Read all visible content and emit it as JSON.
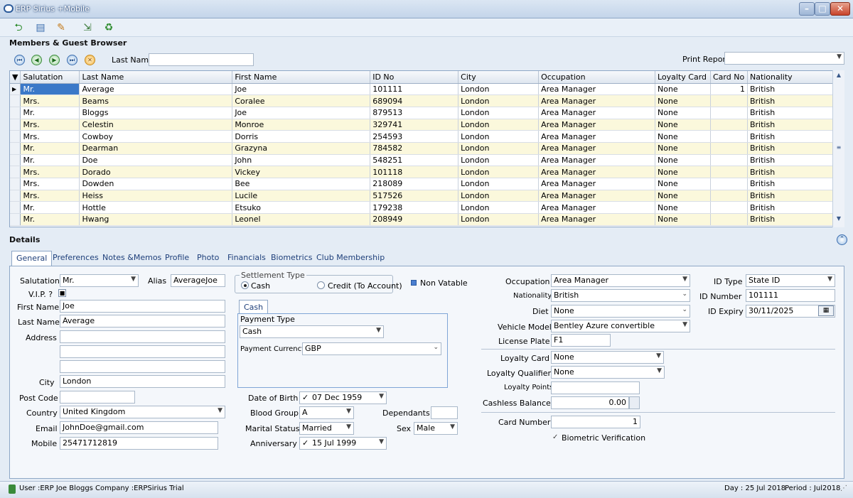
{
  "window": {
    "title": "ERP Sirius +Mobile",
    "minimize": "–",
    "maximize": "□",
    "close": "✕"
  },
  "toolbar": {
    "icons": [
      "refresh-icon",
      "new-document-icon",
      "edit-document-icon",
      "export-icon",
      "recycle-icon"
    ]
  },
  "browser": {
    "title": "Members & Guest Browser",
    "last_name_label": "Last Name",
    "last_name_value": "",
    "print_report_label": "Print Report",
    "print_report_value": ""
  },
  "grid": {
    "columns": [
      "Salutation",
      "Last Name",
      "First Name",
      "ID No",
      "City",
      "Occupation",
      "Loyalty Card",
      "Card No",
      "Nationality"
    ],
    "rows": [
      [
        "Mr.",
        "Average",
        "Joe",
        "101111",
        "London",
        "Area Manager",
        "None",
        "1",
        "British"
      ],
      [
        "Mrs.",
        "Beams",
        "Coralee",
        "689094",
        "London",
        "Area Manager",
        "None",
        "",
        "British"
      ],
      [
        "Mr.",
        "Bloggs",
        "Joe",
        "879513",
        "London",
        "Area Manager",
        "None",
        "",
        "British"
      ],
      [
        "Mrs.",
        "Celestin",
        "Monroe",
        "329741",
        "London",
        "Area Manager",
        "None",
        "",
        "British"
      ],
      [
        "Mrs.",
        "Cowboy",
        "Dorris",
        "254593",
        "London",
        "Area Manager",
        "None",
        "",
        "British"
      ],
      [
        "Mr.",
        "Dearman",
        "Grazyna",
        "784582",
        "London",
        "Area Manager",
        "None",
        "",
        "British"
      ],
      [
        "Mr.",
        "Doe",
        "John",
        "548251",
        "London",
        "Area Manager",
        "None",
        "",
        "British"
      ],
      [
        "Mrs.",
        "Dorado",
        "Vickey",
        "101118",
        "London",
        "Area Manager",
        "None",
        "",
        "British"
      ],
      [
        "Mrs.",
        "Dowden",
        "Bee",
        "218089",
        "London",
        "Area Manager",
        "None",
        "",
        "British"
      ],
      [
        "Mrs.",
        "Heiss",
        "Lucile",
        "517526",
        "London",
        "Area Manager",
        "None",
        "",
        "British"
      ],
      [
        "Mr.",
        "Hottle",
        "Etsuko",
        "179238",
        "London",
        "Area Manager",
        "None",
        "",
        "British"
      ],
      [
        "Mr.",
        "Hwang",
        "Leonel",
        "208949",
        "London",
        "Area Manager",
        "None",
        "",
        "British"
      ]
    ]
  },
  "details": {
    "title": "Details",
    "tabs": [
      "General",
      "Preferences",
      "Notes &Memos",
      "Profile",
      "Photo",
      "Financials",
      "Biometrics",
      "Club Membership"
    ],
    "salutation_label": "Salutation",
    "salutation_value": "Mr.",
    "alias_label": "Alias",
    "alias_value": "AverageJoe",
    "vip_label": "V.I.P. ?",
    "first_name_label": "First Name",
    "first_name_value": "Joe",
    "last_name_label": "Last Name",
    "last_name_value": "Average",
    "address_label": "Address",
    "city_label": "City",
    "city_value": "London",
    "post_code_label": "Post Code",
    "post_code_value": "",
    "country_label": "Country",
    "country_value": "United Kingdom",
    "email_label": "Email",
    "email_value": "JohnDoe@gmail.com",
    "mobile_label": "Mobile",
    "mobile_value": "25471712819",
    "settlement_label": "Settlement Type",
    "cash_label": "Cash",
    "credit_label": "Credit (To Account)",
    "non_vatable_label": "Non Vatable",
    "cash_tab": "Cash",
    "payment_type_label": "Payment Type",
    "payment_type_value": "Cash",
    "payment_currency_label": "Payment Currency",
    "payment_currency_value": "GBP",
    "dob_label": "Date of Birth",
    "dob_value": "07 Dec 1959",
    "blood_group_label": "Blood Group",
    "blood_group_value": "A",
    "dependants_label": "Dependants",
    "dependants_value": "",
    "marital_label": "Marital Status",
    "marital_value": "Married",
    "sex_label": "Sex",
    "sex_value": "Male",
    "anniversary_label": "Anniversary",
    "anniversary_value": "15 Jul 1999",
    "occupation_label": "Occupation",
    "occupation_value": "Area Manager",
    "nationality_label": "Nationality",
    "nationality_value": "British",
    "diet_label": "Diet",
    "diet_value": "None",
    "vehicle_label": "Vehicle Model",
    "vehicle_value": "Bentley Azure convertible",
    "plate_label": "License Plate",
    "plate_value": "F1",
    "id_type_label": "ID Type",
    "id_type_value": "State ID",
    "id_number_label": "ID Number",
    "id_number_value": "101111",
    "id_expiry_label": "ID Expiry",
    "id_expiry_value": "30/11/2025",
    "loyalty_card_label": "Loyalty Card",
    "loyalty_card_value": "None",
    "loyalty_qualifier_label": "Loyalty Qualifier",
    "loyalty_qualifier_value": "None",
    "loyalty_points_label": "Loyalty Points",
    "loyalty_points_value": "",
    "cashless_label": "Cashless Balance",
    "cashless_value": "0.00",
    "card_number_label": "Card Number",
    "card_number_value": "1",
    "biometric_label": "Biometric Verification"
  },
  "status": {
    "user": "User :ERP Joe Bloggs",
    "company": "Company :ERPSirius Trial",
    "day": "Day : 25 Jul 2018",
    "period": "Period : Jul2018"
  }
}
